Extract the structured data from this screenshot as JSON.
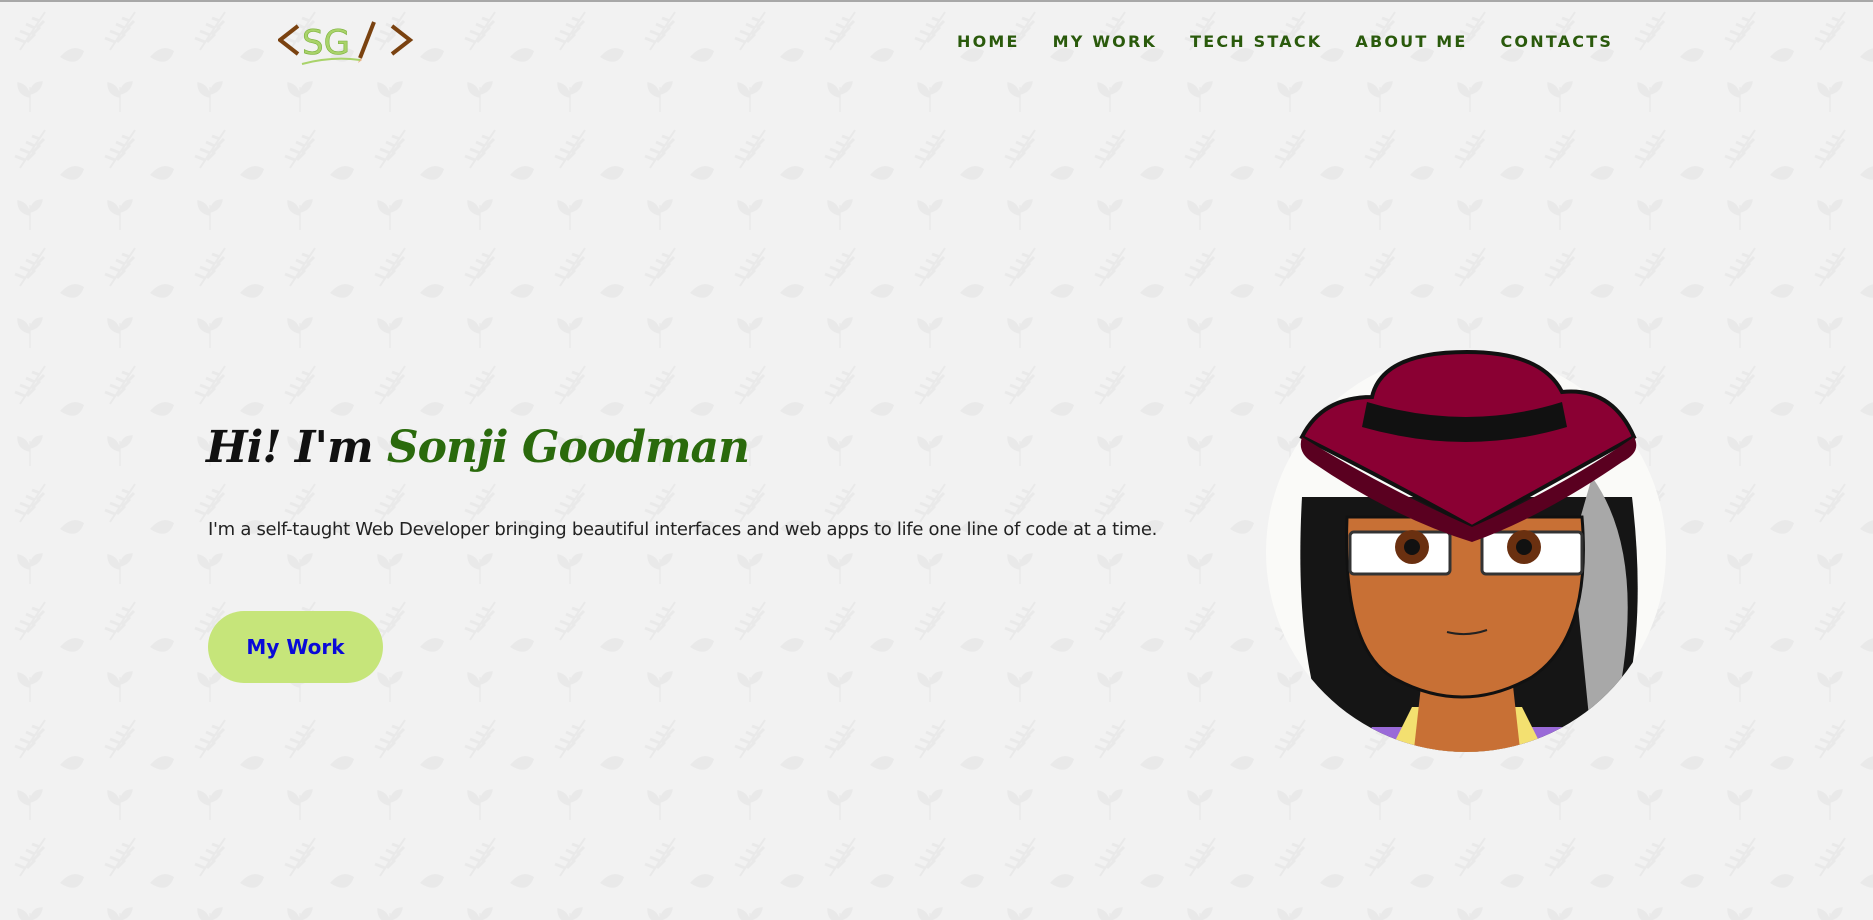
{
  "header": {
    "logo_text": "<SG/>",
    "nav": [
      {
        "label": "HOME"
      },
      {
        "label": "MY WORK"
      },
      {
        "label": "TECH STACK"
      },
      {
        "label": "ABOUT ME"
      },
      {
        "label": "CONTACTS"
      }
    ]
  },
  "hero": {
    "greeting": "Hi! I'm",
    "name": "Sonji Goodman",
    "subtitle": "I'm a self-taught Web Developer bringing beautiful interfaces and web apps to life one line of code at a time.",
    "cta_label": "My Work"
  },
  "colors": {
    "accent_green": "#2a6a0c",
    "button_bg": "#c6e57a",
    "button_text": "#0a0ad8",
    "hat": "#8a0033"
  }
}
